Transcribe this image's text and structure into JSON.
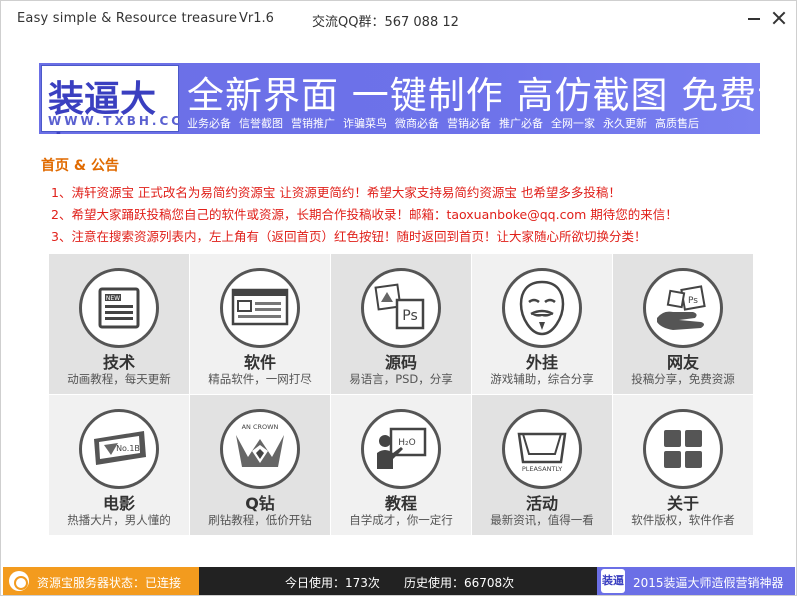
{
  "window": {
    "title": "Easy simple & Resource treasure",
    "version": "Vr1.6",
    "qq_group": "交流QQ群：567 088 12"
  },
  "banner": {
    "logo_text": "装逼大师",
    "logo_url": "WWW.TXBH.CC",
    "slogan": "全新界面 一键制作 高仿截图 免费试用",
    "tags": [
      "业务必备",
      "信誉截图",
      "营销推广",
      "诈骗菜鸟",
      "微商必备",
      "营销必备",
      "推广必备",
      "全网一家",
      "永久更新",
      "高质售后"
    ]
  },
  "notice": {
    "title": "首页 & 公告",
    "items": [
      "1、涛轩资源宝 正式改名为易简约资源宝   让资源更简约！希望大家支持易简约资源宝 也希望多多投稿！",
      "2、希望大家踊跃投稿您自己的软件或资源，长期合作投稿收录！邮箱：taoxuanboke@qq.com    期待您的来信！",
      "3、注意在搜索资源列表内，左上角有（返回首页）红色按钮！随时返回到首页！让大家随心所欲切换分类！"
    ]
  },
  "tiles": [
    {
      "name": "技术",
      "desc": "动画教程，每天更新",
      "icon": "newspaper-icon"
    },
    {
      "name": "软件",
      "desc": "精品软件，一网打尽",
      "icon": "software-window-icon"
    },
    {
      "name": "源码",
      "desc": "易语言，PSD，分享",
      "icon": "photoshop-icon"
    },
    {
      "name": "外挂",
      "desc": "游戏辅助，综合分享",
      "icon": "anonymous-mask-icon"
    },
    {
      "name": "网友",
      "desc": "投稿分享，免费资源",
      "icon": "hand-icon"
    },
    {
      "name": "电影",
      "desc": "热播大片，男人懂的",
      "icon": "film-icon"
    },
    {
      "name": "Q钻",
      "desc": "刷钻教程，低价开钻",
      "icon": "crown-diamond-icon",
      "icon_text": "AN CROWN"
    },
    {
      "name": "教程",
      "desc": "自学成才，你一定行",
      "icon": "teacher-board-icon"
    },
    {
      "name": "活动",
      "desc": "最新资讯，值得一看",
      "icon": "gift-box-icon",
      "icon_text": "PLEASANTLY"
    },
    {
      "name": "关于",
      "desc": "软件版权，软件作者",
      "icon": "grid-apps-icon"
    }
  ],
  "statusbar": {
    "server_status": "资源宝服务器状态：已连接",
    "today_usage": "今日使用：173次",
    "history_usage": "历史使用：66708次",
    "promo": "2015装逼大师造假营销神器",
    "promo_logo": "装逼"
  },
  "colors": {
    "banner_bg": "#6b6fe6",
    "notice_title": "#e06a00",
    "notice_text": "#e0201a",
    "status_orange": "#f39b1e",
    "status_dark": "#222222"
  }
}
